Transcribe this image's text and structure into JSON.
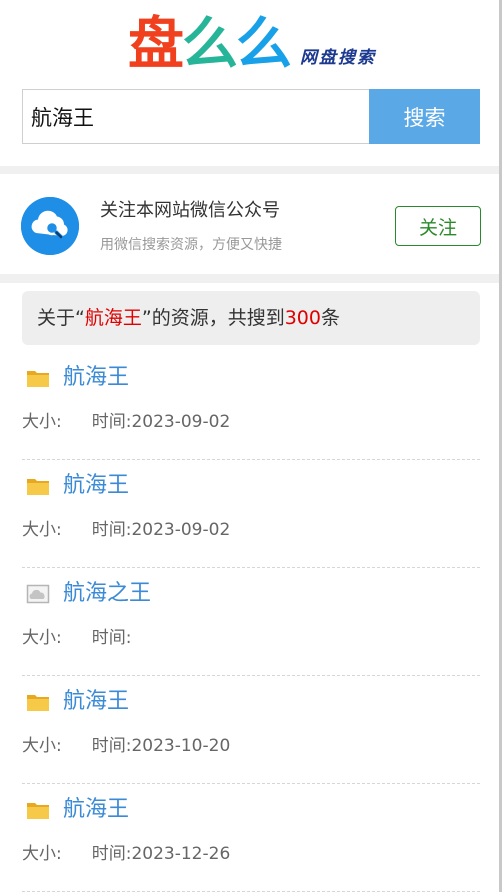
{
  "logo": {
    "chars": [
      {
        "text": "盘",
        "color": "#f0401e"
      },
      {
        "text": "么",
        "color": "#27b59a"
      },
      {
        "text": "么",
        "color": "#18a0e8"
      }
    ],
    "subtitle": "网盘搜索"
  },
  "search": {
    "value": "航海王",
    "button_label": "搜索"
  },
  "follow": {
    "title": "关注本网站微信公众号",
    "subtitle": "用微信搜索资源，方便又快捷",
    "button_label": "关注",
    "icon": "cloud-search-icon"
  },
  "result_summary": {
    "prefix": "关于“",
    "keyword": "航海王",
    "middle": "”的资源，共搜到",
    "count": "300",
    "suffix": "条"
  },
  "results": [
    {
      "icon": "folder-icon",
      "title": "航海王",
      "size_label": "大小:",
      "size_value": "",
      "time_label": "时间:",
      "time_value": "2023-09-02"
    },
    {
      "icon": "folder-icon",
      "title": "航海王",
      "size_label": "大小:",
      "size_value": "",
      "time_label": "时间:",
      "time_value": "2023-09-02"
    },
    {
      "icon": "image-icon",
      "title": "航海之王",
      "size_label": "大小:",
      "size_value": "",
      "time_label": "时间:",
      "time_value": ""
    },
    {
      "icon": "folder-icon",
      "title": "航海王",
      "size_label": "大小:",
      "size_value": "",
      "time_label": "时间:",
      "time_value": "2023-10-20"
    },
    {
      "icon": "folder-icon",
      "title": "航海王",
      "size_label": "大小:",
      "size_value": "",
      "time_label": "时间:",
      "time_value": "2023-12-26"
    }
  ],
  "colors": {
    "accent": "#5aa8e6",
    "link": "#3b8ad6",
    "highlight": "#e00000",
    "follow_green": "#2a8a2a"
  }
}
